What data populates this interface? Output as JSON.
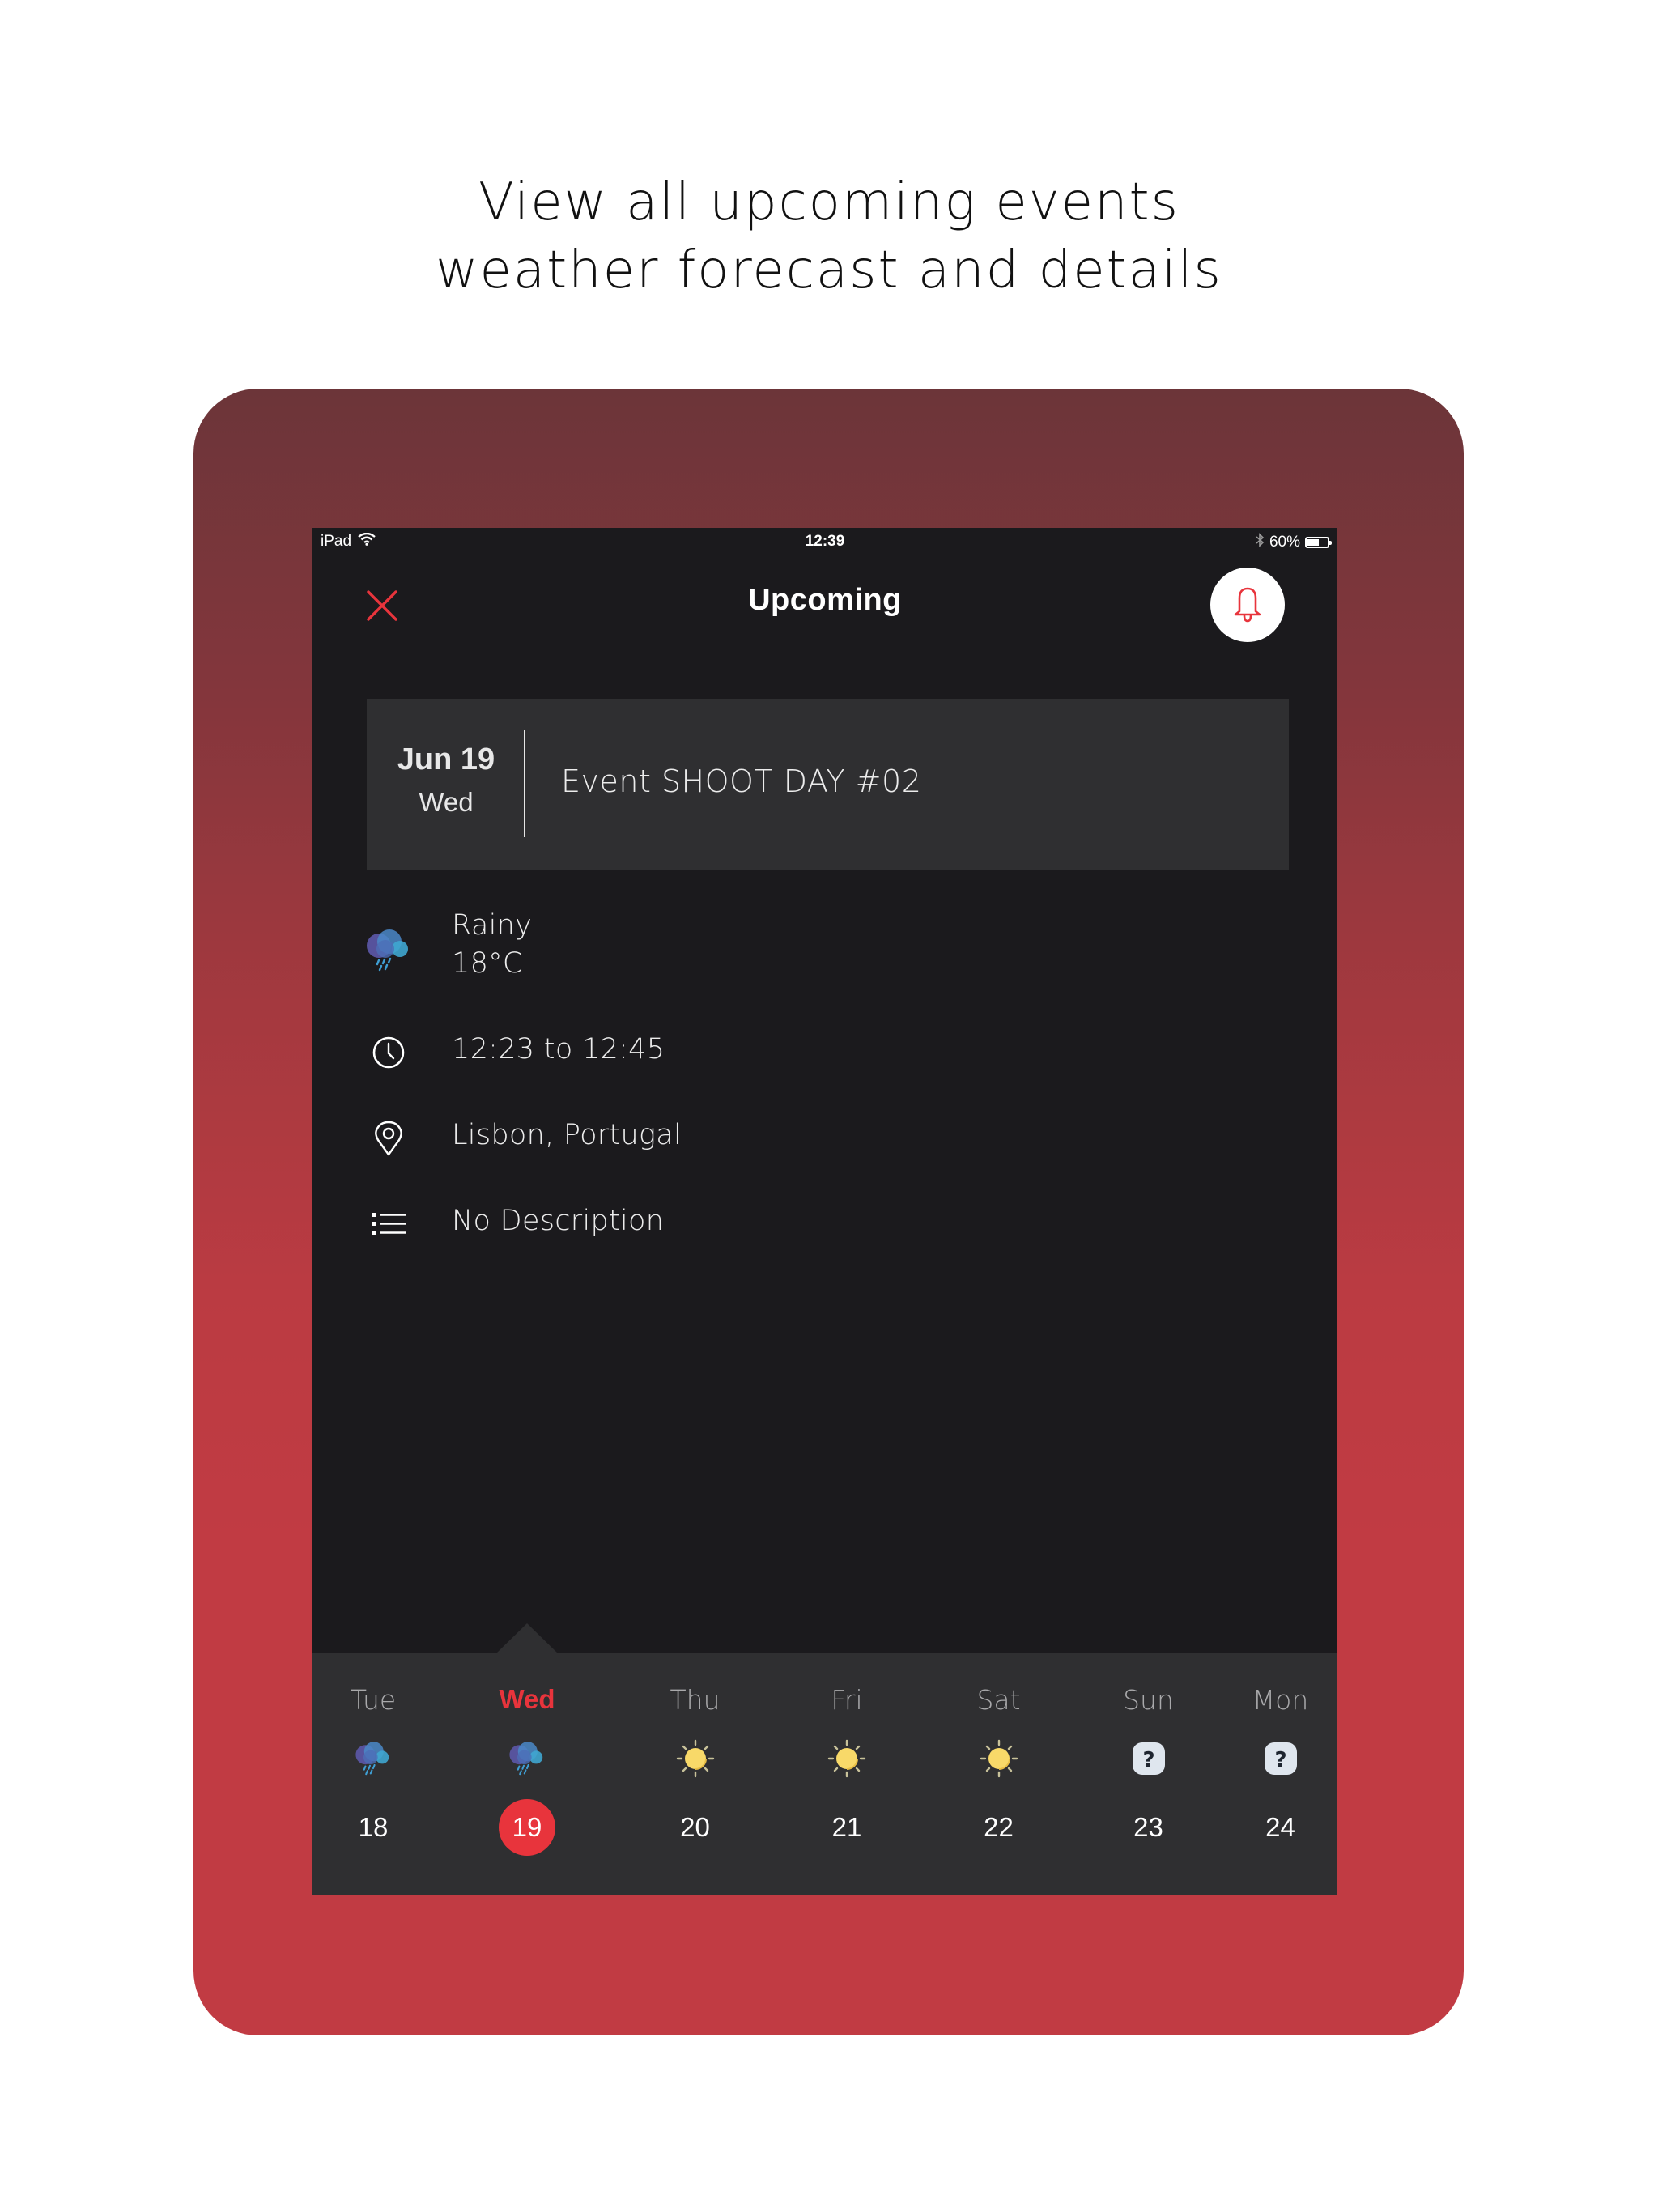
{
  "headline": {
    "line1": "View all upcoming events",
    "line2": "weather forecast and details"
  },
  "colors": {
    "accent": "#e8343c",
    "screen_bg": "#1b1a1d",
    "card_bg": "#2f2f31",
    "frame_top": "#6c3539",
    "frame_bottom": "#c13b43"
  },
  "status_bar": {
    "device": "iPad",
    "wifi_icon": "wifi-icon",
    "time": "12:39",
    "bluetooth_icon": "bluetooth-icon",
    "battery_label": "60%",
    "battery_level": 0.6
  },
  "nav": {
    "close_icon": "close-icon",
    "title": "Upcoming",
    "bell_icon": "bell-icon"
  },
  "event": {
    "month_day": "Jun 19",
    "weekday": "Wed",
    "title": "Event SHOOT DAY #02"
  },
  "details": {
    "weather": {
      "icon": "rain-cloud-icon",
      "condition": "Rainy",
      "temperature": "18°C"
    },
    "time": {
      "icon": "clock-icon",
      "text": "12:23 to 12:45"
    },
    "location": {
      "icon": "location-pin-icon",
      "text": "Lisbon, Portugal"
    },
    "description": {
      "icon": "list-icon",
      "text": "No Description"
    }
  },
  "forecast": [
    {
      "day": "Tue",
      "date": "18",
      "icon": "rain-cloud-icon",
      "selected": false
    },
    {
      "day": "Wed",
      "date": "19",
      "icon": "rain-cloud-icon",
      "selected": true
    },
    {
      "day": "Thu",
      "date": "20",
      "icon": "sun-icon",
      "selected": false
    },
    {
      "day": "Fri",
      "date": "21",
      "icon": "sun-icon",
      "selected": false
    },
    {
      "day": "Sat",
      "date": "22",
      "icon": "sun-icon",
      "selected": false
    },
    {
      "day": "Sun",
      "date": "23",
      "icon": "unknown-weather-icon",
      "selected": false
    },
    {
      "day": "Mon",
      "date": "24",
      "icon": "unknown-weather-icon",
      "selected": false
    }
  ]
}
